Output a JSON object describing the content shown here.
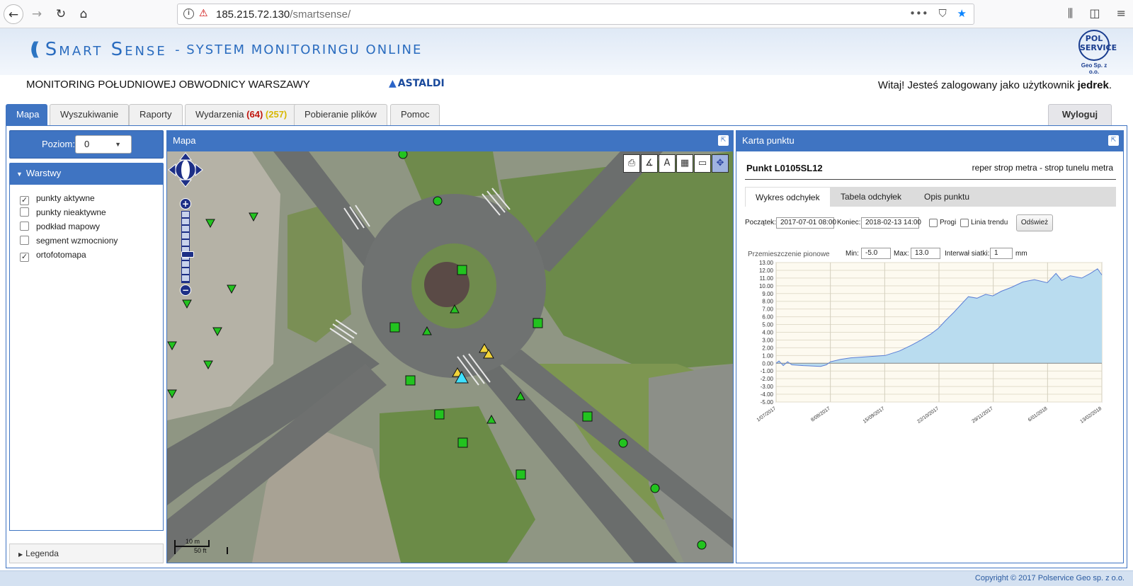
{
  "browser": {
    "url_host": "185.215.72.130",
    "url_path": "/smartsense/"
  },
  "header": {
    "logo_main": "Smart Sense",
    "logo_sub": "- SYSTEM MONITORINGU ONLINE",
    "partner_logo_lines": [
      "POL",
      "SERVICE",
      "Geo Sp. z o.o."
    ],
    "project_title": "MONITORING POŁUDNIOWEJ OBWODNICY WARSZAWY",
    "contractor_logo": "ASTALDI",
    "welcome_prefix": "Witaj! Jesteś zalogowany jako użytkownik",
    "username": "jedrek",
    "welcome_suffix": "."
  },
  "tabs": {
    "map": "Mapa",
    "search": "Wyszukiwanie",
    "reports": "Raporty",
    "events_label": "Wydarzenia",
    "events_red": "(64)",
    "events_yellow": "(257)",
    "downloads": "Pobieranie plików",
    "help": "Pomoc",
    "logout": "Wyloguj"
  },
  "left_panel": {
    "level_label": "Poziom:",
    "level_value": "0",
    "layers_title": "Warstwy",
    "layers": [
      {
        "label": "punkty aktywne",
        "checked": true
      },
      {
        "label": "punkty nieaktywne",
        "checked": false
      },
      {
        "label": "podkład mapowy",
        "checked": false
      },
      {
        "label": "segment wzmocniony",
        "checked": false
      },
      {
        "label": "ortofotomapa",
        "checked": true
      }
    ],
    "legend_label": "Legenda"
  },
  "map_panel": {
    "title": "Mapa",
    "scale_metric": "10 m",
    "scale_imperial": "50 ft",
    "colors": {
      "sensor_ok": "#22c31f",
      "sensor_warning": "#f1d43a",
      "sensor_selected": "#3fe0ff"
    }
  },
  "point_card": {
    "panel_title": "Karta punktu",
    "point_name": "Punkt L0105SL12",
    "point_description": "reper strop metra - strop tunelu metra",
    "sub_tabs": [
      "Wykres odchyłek",
      "Tabela odchyłek",
      "Opis punktu"
    ],
    "start_label": "Początek:",
    "start_value": "2017-07-01 08:00",
    "end_label": "Koniec:",
    "end_value": "2018-02-13 14:00",
    "thresholds_label": "Progi",
    "trend_label": "Linia trendu",
    "refresh_label": "Odśwież",
    "chart_title": "Przemieszczenie pionowe",
    "min_label": "Min:",
    "min_value": "-5.0",
    "max_label": "Max:",
    "max_value": "13.0",
    "grid_label": "Interwał siatki:",
    "grid_value": "1",
    "unit_label": "mm"
  },
  "chart_data": {
    "type": "area",
    "title": "Przemieszczenie pionowe",
    "xlabel": "",
    "ylabel": "",
    "ylim": [
      -5,
      13
    ],
    "xlim": [
      "2017-07-01",
      "2018-02-13"
    ],
    "y_ticks": [
      "13.00",
      "12.00",
      "11.00",
      "10.00",
      "9.00",
      "8.00",
      "7.00",
      "6.00",
      "5.00",
      "4.00",
      "3.00",
      "2.00",
      "1.00",
      "0.00",
      "-1.00",
      "-2.00",
      "-3.00",
      "-4.00",
      "-5.00"
    ],
    "x_tick_labels": [
      "1/07/2017",
      "8/08/2017",
      "15/09/2017",
      "22/10/2017",
      "29/11/2017",
      "6/01/2018",
      "13/02/2018"
    ],
    "grid": true,
    "color": "#5c7fd6",
    "fill": "#b9dcef",
    "x": [
      "2017-07-01",
      "2017-07-03",
      "2017-07-06",
      "2017-07-09",
      "2017-07-12",
      "2017-07-20",
      "2017-08-01",
      "2017-08-05",
      "2017-08-08",
      "2017-08-15",
      "2017-08-22",
      "2017-08-30",
      "2017-09-07",
      "2017-09-15",
      "2017-09-25",
      "2017-10-03",
      "2017-10-10",
      "2017-10-17",
      "2017-10-22",
      "2017-10-27",
      "2017-11-02",
      "2017-11-08",
      "2017-11-12",
      "2017-11-18",
      "2017-11-24",
      "2017-11-29",
      "2017-12-05",
      "2017-12-12",
      "2017-12-20",
      "2017-12-28",
      "2018-01-06",
      "2018-01-12",
      "2018-01-16",
      "2018-01-22",
      "2018-01-30",
      "2018-02-05",
      "2018-02-10",
      "2018-02-13"
    ],
    "y": [
      0.0,
      0.3,
      -0.3,
      0.2,
      -0.2,
      -0.3,
      -0.4,
      -0.2,
      0.2,
      0.5,
      0.7,
      0.8,
      0.9,
      1.0,
      1.6,
      2.3,
      3.0,
      3.8,
      4.5,
      5.5,
      6.6,
      7.8,
      8.6,
      8.4,
      8.9,
      8.7,
      9.3,
      9.8,
      10.5,
      10.8,
      10.4,
      11.6,
      10.7,
      11.3,
      11.0,
      11.6,
      12.2,
      11.4
    ]
  }
}
